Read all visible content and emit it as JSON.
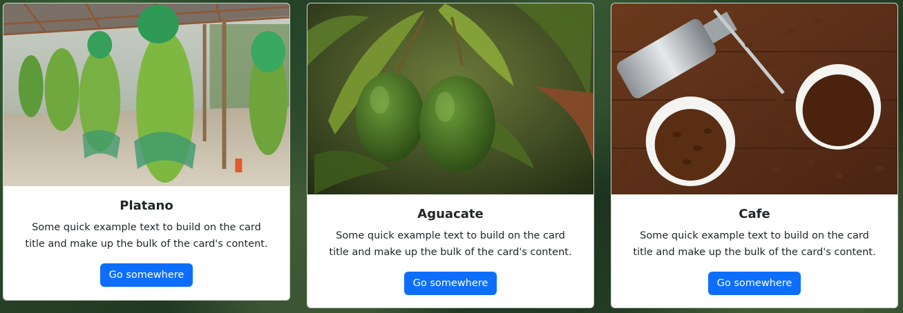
{
  "cards": [
    {
      "title": "Platano",
      "text": "Some quick example text to build on the card title and make up the bulk of the card's content.",
      "button_label": "Go somewhere",
      "image": "banana-plantation-image"
    },
    {
      "title": "Aguacate",
      "text": "Some quick example text to build on the card title and make up the bulk of the card's content.",
      "button_label": "Go somewhere",
      "image": "avocado-tree-image"
    },
    {
      "title": "Cafe",
      "text": "Some quick example text to build on the card title and make up the bulk of the card's content.",
      "button_label": "Go somewhere",
      "image": "coffee-beans-image"
    }
  ],
  "colors": {
    "button": "#0d6efd",
    "button_text": "#ffffff",
    "card_bg": "#ffffff",
    "text": "#212529"
  }
}
